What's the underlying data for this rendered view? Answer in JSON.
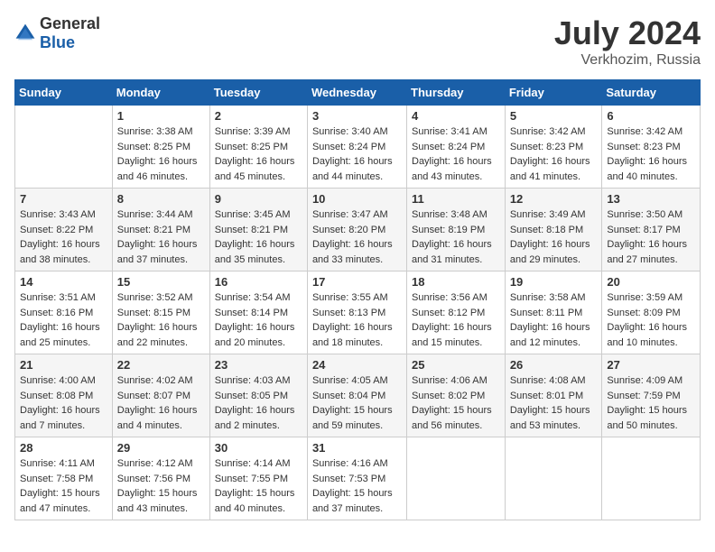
{
  "header": {
    "logo_general": "General",
    "logo_blue": "Blue",
    "month_year": "July 2024",
    "location": "Verkhozim, Russia"
  },
  "calendar": {
    "days_of_week": [
      "Sunday",
      "Monday",
      "Tuesday",
      "Wednesday",
      "Thursday",
      "Friday",
      "Saturday"
    ],
    "weeks": [
      [
        {
          "day": "",
          "sunrise": "",
          "sunset": "",
          "daylight": ""
        },
        {
          "day": "1",
          "sunrise": "Sunrise: 3:38 AM",
          "sunset": "Sunset: 8:25 PM",
          "daylight": "Daylight: 16 hours and 46 minutes."
        },
        {
          "day": "2",
          "sunrise": "Sunrise: 3:39 AM",
          "sunset": "Sunset: 8:25 PM",
          "daylight": "Daylight: 16 hours and 45 minutes."
        },
        {
          "day": "3",
          "sunrise": "Sunrise: 3:40 AM",
          "sunset": "Sunset: 8:24 PM",
          "daylight": "Daylight: 16 hours and 44 minutes."
        },
        {
          "day": "4",
          "sunrise": "Sunrise: 3:41 AM",
          "sunset": "Sunset: 8:24 PM",
          "daylight": "Daylight: 16 hours and 43 minutes."
        },
        {
          "day": "5",
          "sunrise": "Sunrise: 3:42 AM",
          "sunset": "Sunset: 8:23 PM",
          "daylight": "Daylight: 16 hours and 41 minutes."
        },
        {
          "day": "6",
          "sunrise": "Sunrise: 3:42 AM",
          "sunset": "Sunset: 8:23 PM",
          "daylight": "Daylight: 16 hours and 40 minutes."
        }
      ],
      [
        {
          "day": "7",
          "sunrise": "Sunrise: 3:43 AM",
          "sunset": "Sunset: 8:22 PM",
          "daylight": "Daylight: 16 hours and 38 minutes."
        },
        {
          "day": "8",
          "sunrise": "Sunrise: 3:44 AM",
          "sunset": "Sunset: 8:21 PM",
          "daylight": "Daylight: 16 hours and 37 minutes."
        },
        {
          "day": "9",
          "sunrise": "Sunrise: 3:45 AM",
          "sunset": "Sunset: 8:21 PM",
          "daylight": "Daylight: 16 hours and 35 minutes."
        },
        {
          "day": "10",
          "sunrise": "Sunrise: 3:47 AM",
          "sunset": "Sunset: 8:20 PM",
          "daylight": "Daylight: 16 hours and 33 minutes."
        },
        {
          "day": "11",
          "sunrise": "Sunrise: 3:48 AM",
          "sunset": "Sunset: 8:19 PM",
          "daylight": "Daylight: 16 hours and 31 minutes."
        },
        {
          "day": "12",
          "sunrise": "Sunrise: 3:49 AM",
          "sunset": "Sunset: 8:18 PM",
          "daylight": "Daylight: 16 hours and 29 minutes."
        },
        {
          "day": "13",
          "sunrise": "Sunrise: 3:50 AM",
          "sunset": "Sunset: 8:17 PM",
          "daylight": "Daylight: 16 hours and 27 minutes."
        }
      ],
      [
        {
          "day": "14",
          "sunrise": "Sunrise: 3:51 AM",
          "sunset": "Sunset: 8:16 PM",
          "daylight": "Daylight: 16 hours and 25 minutes."
        },
        {
          "day": "15",
          "sunrise": "Sunrise: 3:52 AM",
          "sunset": "Sunset: 8:15 PM",
          "daylight": "Daylight: 16 hours and 22 minutes."
        },
        {
          "day": "16",
          "sunrise": "Sunrise: 3:54 AM",
          "sunset": "Sunset: 8:14 PM",
          "daylight": "Daylight: 16 hours and 20 minutes."
        },
        {
          "day": "17",
          "sunrise": "Sunrise: 3:55 AM",
          "sunset": "Sunset: 8:13 PM",
          "daylight": "Daylight: 16 hours and 18 minutes."
        },
        {
          "day": "18",
          "sunrise": "Sunrise: 3:56 AM",
          "sunset": "Sunset: 8:12 PM",
          "daylight": "Daylight: 16 hours and 15 minutes."
        },
        {
          "day": "19",
          "sunrise": "Sunrise: 3:58 AM",
          "sunset": "Sunset: 8:11 PM",
          "daylight": "Daylight: 16 hours and 12 minutes."
        },
        {
          "day": "20",
          "sunrise": "Sunrise: 3:59 AM",
          "sunset": "Sunset: 8:09 PM",
          "daylight": "Daylight: 16 hours and 10 minutes."
        }
      ],
      [
        {
          "day": "21",
          "sunrise": "Sunrise: 4:00 AM",
          "sunset": "Sunset: 8:08 PM",
          "daylight": "Daylight: 16 hours and 7 minutes."
        },
        {
          "day": "22",
          "sunrise": "Sunrise: 4:02 AM",
          "sunset": "Sunset: 8:07 PM",
          "daylight": "Daylight: 16 hours and 4 minutes."
        },
        {
          "day": "23",
          "sunrise": "Sunrise: 4:03 AM",
          "sunset": "Sunset: 8:05 PM",
          "daylight": "Daylight: 16 hours and 2 minutes."
        },
        {
          "day": "24",
          "sunrise": "Sunrise: 4:05 AM",
          "sunset": "Sunset: 8:04 PM",
          "daylight": "Daylight: 15 hours and 59 minutes."
        },
        {
          "day": "25",
          "sunrise": "Sunrise: 4:06 AM",
          "sunset": "Sunset: 8:02 PM",
          "daylight": "Daylight: 15 hours and 56 minutes."
        },
        {
          "day": "26",
          "sunrise": "Sunrise: 4:08 AM",
          "sunset": "Sunset: 8:01 PM",
          "daylight": "Daylight: 15 hours and 53 minutes."
        },
        {
          "day": "27",
          "sunrise": "Sunrise: 4:09 AM",
          "sunset": "Sunset: 7:59 PM",
          "daylight": "Daylight: 15 hours and 50 minutes."
        }
      ],
      [
        {
          "day": "28",
          "sunrise": "Sunrise: 4:11 AM",
          "sunset": "Sunset: 7:58 PM",
          "daylight": "Daylight: 15 hours and 47 minutes."
        },
        {
          "day": "29",
          "sunrise": "Sunrise: 4:12 AM",
          "sunset": "Sunset: 7:56 PM",
          "daylight": "Daylight: 15 hours and 43 minutes."
        },
        {
          "day": "30",
          "sunrise": "Sunrise: 4:14 AM",
          "sunset": "Sunset: 7:55 PM",
          "daylight": "Daylight: 15 hours and 40 minutes."
        },
        {
          "day": "31",
          "sunrise": "Sunrise: 4:16 AM",
          "sunset": "Sunset: 7:53 PM",
          "daylight": "Daylight: 15 hours and 37 minutes."
        },
        {
          "day": "",
          "sunrise": "",
          "sunset": "",
          "daylight": ""
        },
        {
          "day": "",
          "sunrise": "",
          "sunset": "",
          "daylight": ""
        },
        {
          "day": "",
          "sunrise": "",
          "sunset": "",
          "daylight": ""
        }
      ]
    ]
  }
}
